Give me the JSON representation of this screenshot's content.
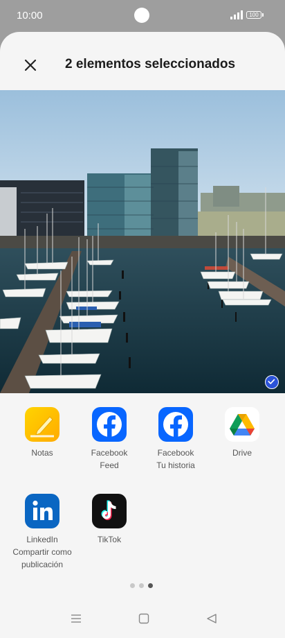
{
  "status": {
    "time": "10:00",
    "battery": "100"
  },
  "header": {
    "title": "2 elementos seleccionados"
  },
  "apps": [
    {
      "line1": "Notas",
      "line2": "",
      "icon": "notes-icon"
    },
    {
      "line1": "Facebook",
      "line2": "Feed",
      "icon": "facebook-icon"
    },
    {
      "line1": "Facebook",
      "line2": "Tu historia",
      "icon": "facebook-icon"
    },
    {
      "line1": "Drive",
      "line2": "",
      "icon": "drive-icon"
    },
    {
      "line1": "LinkedIn",
      "line2": "Compartir como publicación",
      "icon": "linkedin-icon"
    },
    {
      "line1": "TikTok",
      "line2": "",
      "icon": "tiktok-icon"
    }
  ],
  "pager": {
    "pages": 3,
    "current": 3
  },
  "colors": {
    "facebook": "#0866ff",
    "linkedin": "#0a66c2",
    "notes": "#ffc400",
    "check": "#2b53d8"
  }
}
